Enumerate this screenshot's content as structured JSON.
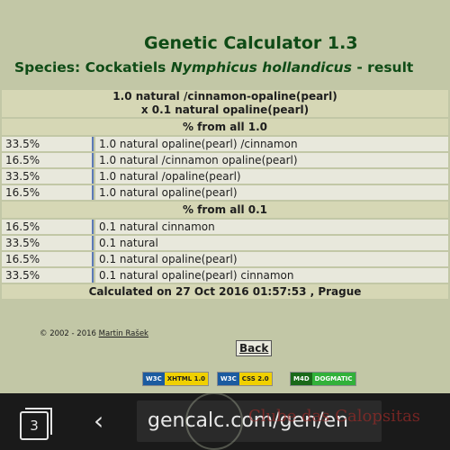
{
  "title": "Genetic Calculator 1.3",
  "species": {
    "prefix": "Species: Cockatiels ",
    "latin": "Nymphicus hollandicus",
    "suffix": " - result"
  },
  "pairing": {
    "male": "1.0 natural /cinnamon-opaline(pearl)",
    "female": "x 0.1 natural opaline(pearl)"
  },
  "sections": [
    {
      "label": "% from all 1.0",
      "rows": [
        {
          "pct": "33.5%",
          "result": "1.0 natural opaline(pearl) /cinnamon"
        },
        {
          "pct": "16.5%",
          "result": "1.0 natural /cinnamon opaline(pearl)"
        },
        {
          "pct": "33.5%",
          "result": "1.0 natural /opaline(pearl)"
        },
        {
          "pct": "16.5%",
          "result": "1.0 natural opaline(pearl)"
        }
      ]
    },
    {
      "label": "% from all 0.1",
      "rows": [
        {
          "pct": "16.5%",
          "result": "0.1 natural cinnamon"
        },
        {
          "pct": "33.5%",
          "result": "0.1 natural"
        },
        {
          "pct": "16.5%",
          "result": "0.1 natural opaline(pearl)"
        },
        {
          "pct": "33.5%",
          "result": "0.1 natural opaline(pearl) cinnamon"
        }
      ]
    }
  ],
  "calculated": "Calculated on 27 Oct 2016 01:57:53 , Prague",
  "copyright": {
    "text": "© 2002 - 2016 ",
    "author": "Martin Rašek"
  },
  "back_label": "Back",
  "badges": [
    {
      "left": "W3C",
      "right": "XHTML 1.0",
      "color": "#1b5ba0",
      "bg": "#f0d000"
    },
    {
      "left": "W3C",
      "right": "CSS 2.0",
      "color": "#1b5ba0",
      "bg": "#f0d000"
    },
    {
      "left": "M4D",
      "right": "DOGMATIC",
      "color": "#1a6a1a",
      "bg": "#31b13a"
    }
  ],
  "browser": {
    "tab_count": "3",
    "url": "gencalc.com/gen/en"
  },
  "watermark": "Clube das Calopsitas",
  "colors": {
    "background": "#c2c7a6",
    "header_green": "#0f4b16",
    "separator_blue": "#5c79b7"
  }
}
